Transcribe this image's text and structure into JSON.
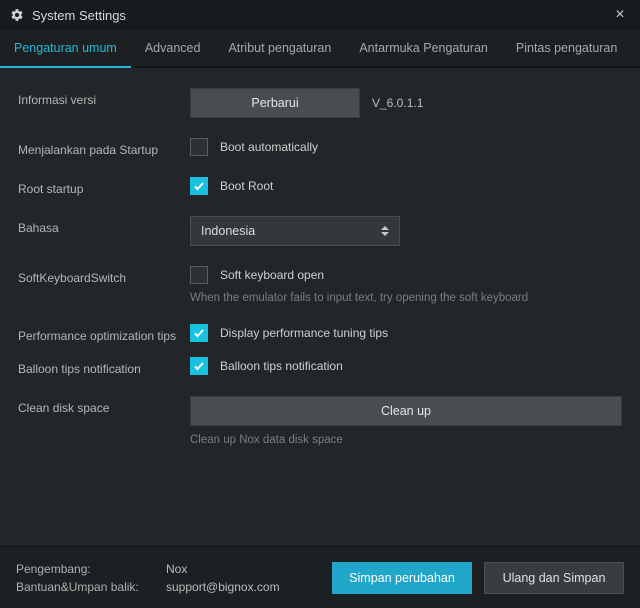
{
  "window": {
    "title": "System Settings"
  },
  "tabs": [
    {
      "label": "Pengaturan umum",
      "active": true
    },
    {
      "label": "Advanced",
      "active": false
    },
    {
      "label": "Atribut pengaturan",
      "active": false
    },
    {
      "label": "Antarmuka Pengaturan",
      "active": false
    },
    {
      "label": "Pintas pengaturan",
      "active": false
    }
  ],
  "rows": {
    "version": {
      "label": "Informasi versi",
      "button": "Perbarui",
      "value": "V_6.0.1.1"
    },
    "startup": {
      "label": "Menjalankan pada Startup",
      "checkbox_label": "Boot automatically",
      "checked": false
    },
    "root": {
      "label": "Root startup",
      "checkbox_label": "Boot Root",
      "checked": true
    },
    "language": {
      "label": "Bahasa",
      "value": "Indonesia"
    },
    "softkb": {
      "label": "SoftKeyboardSwitch",
      "checkbox_label": "Soft keyboard open",
      "checked": false,
      "hint": "When the emulator fails to input text, try opening the soft keyboard"
    },
    "perf": {
      "label": "Performance optimization tips",
      "checkbox_label": "Display performance tuning tips",
      "checked": true
    },
    "balloon": {
      "label": "Balloon tips notification",
      "checkbox_label": "Balloon tips notification",
      "checked": true
    },
    "clean": {
      "label": "Clean disk space",
      "button": "Clean up",
      "hint": "Clean up Nox data disk space"
    }
  },
  "footer": {
    "developer_label": "Pengembang:",
    "developer_value": "Nox",
    "support_label": "Bantuan&Umpan balik:",
    "support_value": "support@bignox.com",
    "save": "Simpan perubahan",
    "reset": "Ulang dan Simpan"
  }
}
